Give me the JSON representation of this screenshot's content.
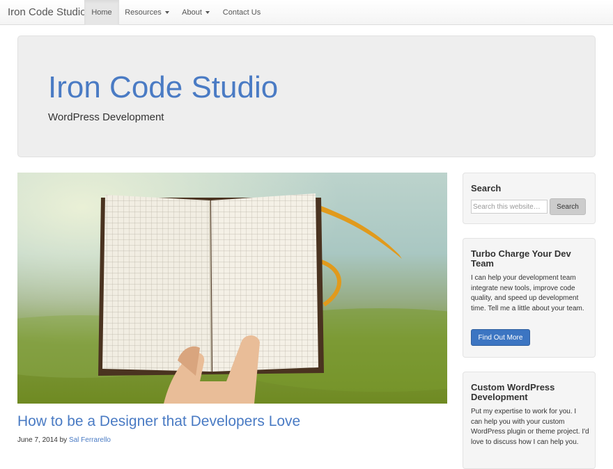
{
  "navbar": {
    "brand": "Iron Code Studio",
    "items": [
      {
        "label": "Home"
      },
      {
        "label": "Resources"
      },
      {
        "label": "About"
      },
      {
        "label": "Contact Us"
      }
    ]
  },
  "header": {
    "title": "Iron Code Studio",
    "description": "WordPress Development"
  },
  "post": {
    "title": "How to be a Designer that Developers Love",
    "date": "June 7, 2014",
    "by": "by",
    "author": "Sal Ferrarello"
  },
  "sidebar": {
    "search": {
      "title": "Search",
      "placeholder": "Search this website…",
      "button": "Search"
    },
    "turbo": {
      "title": "Turbo Charge Your Dev Team",
      "text": "I can help your development team integrate new tools, improve code quality, and speed up development time. Tell me a little about your team.",
      "button": "Find Out More"
    },
    "custom": {
      "title": "Custom WordPress Development",
      "text": "Put my expertise to work for you. I can help you with your custom WordPress plugin or theme project. I'd love to discuss how I can help you."
    }
  },
  "colors": {
    "accent": "#4a7bc4",
    "button_primary": "#3c75c2",
    "jumbotron_bg": "#eeeeee"
  }
}
